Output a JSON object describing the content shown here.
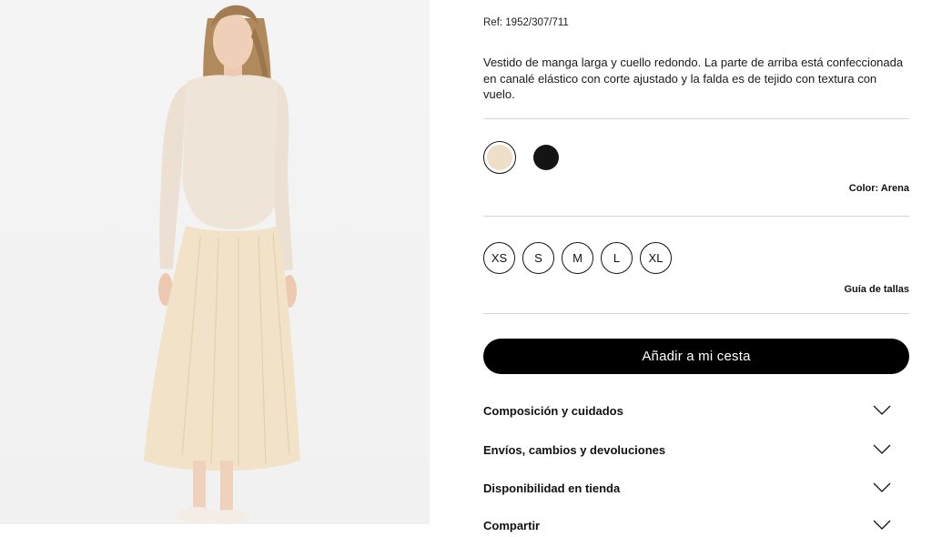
{
  "product": {
    "reference": "Ref: 1952/307/711",
    "description": "Vestido de manga larga y cuello redondo. La parte de arriba está confeccionada en canalé elástico con corte ajustado y la falda es de tejido con textura con vuelo."
  },
  "colors": {
    "options": [
      {
        "name": "arena",
        "hex": "#efdfc8",
        "selected": true
      },
      {
        "name": "negro",
        "hex": "#141414",
        "selected": false
      }
    ],
    "selected_label": "Color: Arena"
  },
  "sizes": {
    "options": [
      "XS",
      "S",
      "M",
      "L",
      "XL"
    ],
    "guide_label": "Guía de tallas"
  },
  "cart": {
    "add_label": "Añadir a mi cesta"
  },
  "accordions": [
    {
      "label": "Composición y cuidados",
      "icon": "chevron-down-icon"
    },
    {
      "label": "Envíos, cambios y devoluciones",
      "icon": "chevron-down-icon"
    },
    {
      "label": "Disponibilidad en tienda",
      "icon": "chevron-down-icon"
    },
    {
      "label": "Compartir",
      "icon": "chevron-down-icon"
    }
  ]
}
